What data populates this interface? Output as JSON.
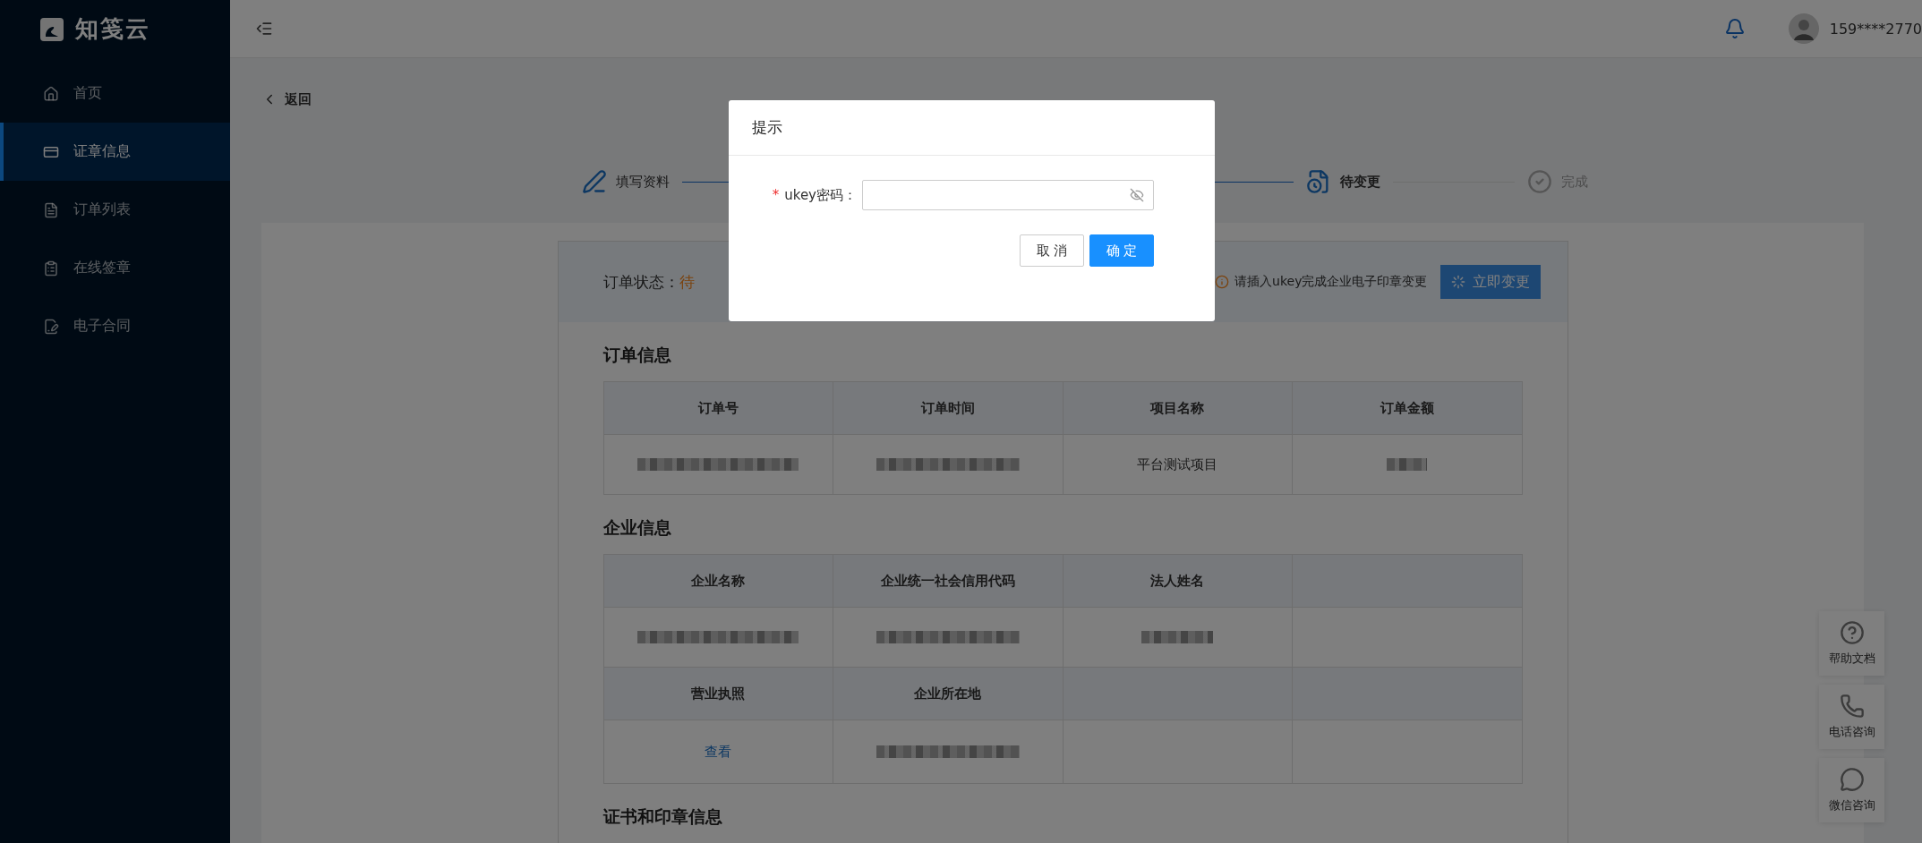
{
  "sidebar": {
    "logo": "知笺云",
    "items": [
      {
        "label": "首页",
        "selected": false
      },
      {
        "label": "证章信息",
        "selected": true
      },
      {
        "label": "订单列表",
        "selected": false
      },
      {
        "label": "在线签章",
        "selected": false
      },
      {
        "label": "电子合同",
        "selected": false
      }
    ]
  },
  "header": {
    "user": "159****2770"
  },
  "back": "返回",
  "steps": [
    {
      "label": "填写资料",
      "finished": true,
      "current": false
    },
    {
      "label": "待变更",
      "finished": false,
      "current": true
    },
    {
      "label": "完成",
      "finished": false,
      "current": false
    }
  ],
  "order_status": {
    "label": "订单状态：",
    "value": "待",
    "hint": "请插入ukey完成企业电子印章变更",
    "button": "立即变更"
  },
  "sections": [
    {
      "title": "订单信息",
      "rows": [
        {
          "kind": "head",
          "cells": [
            {
              "kind": "text",
              "text": "订单号"
            },
            {
              "kind": "text",
              "text": "订单时间"
            },
            {
              "kind": "text",
              "text": "项目名称"
            },
            {
              "kind": "text",
              "text": "订单金额"
            }
          ]
        },
        {
          "kind": "body",
          "cells": [
            {
              "kind": "redacted"
            },
            {
              "kind": "redacted"
            },
            {
              "kind": "text",
              "text": "平台测试项目"
            },
            {
              "kind": "redacted"
            }
          ]
        }
      ]
    },
    {
      "title": "企业信息",
      "rows": [
        {
          "kind": "head",
          "cells": [
            {
              "kind": "text",
              "text": "企业名称"
            },
            {
              "kind": "text",
              "text": "企业统一社会信用代码"
            },
            {
              "kind": "text",
              "text": "法人姓名"
            },
            {
              "kind": "empty"
            }
          ]
        },
        {
          "kind": "body",
          "cells": [
            {
              "kind": "redacted"
            },
            {
              "kind": "redacted"
            },
            {
              "kind": "redacted"
            },
            {
              "kind": "empty"
            }
          ]
        },
        {
          "kind": "head",
          "cells": [
            {
              "kind": "text",
              "text": "营业执照"
            },
            {
              "kind": "text",
              "text": "企业所在地"
            },
            {
              "kind": "empty"
            },
            {
              "kind": "empty"
            }
          ]
        },
        {
          "kind": "body",
          "cells": [
            {
              "kind": "link",
              "text": "查看"
            },
            {
              "kind": "redacted"
            },
            {
              "kind": "empty"
            },
            {
              "kind": "empty"
            }
          ]
        }
      ]
    },
    {
      "title": "证书和印章信息"
    }
  ],
  "float_buttons": [
    {
      "label": "帮助文档"
    },
    {
      "label": "电话咨询"
    },
    {
      "label": "微信咨询"
    }
  ],
  "dialog": {
    "title": "提示",
    "field": {
      "required_mark": "*",
      "label": "ukey密码："
    },
    "buttons": [
      {
        "label": "取 消",
        "kind": "default"
      },
      {
        "label": "确 定",
        "kind": "primary"
      }
    ]
  }
}
